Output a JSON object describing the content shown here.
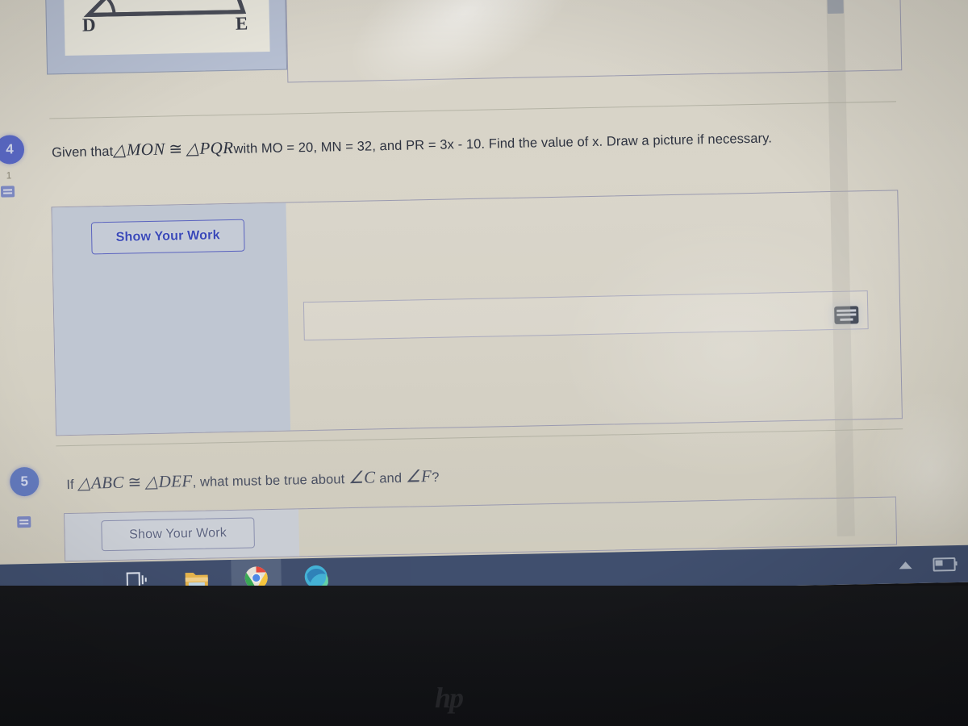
{
  "app": {
    "background_color": "#d6d2c6",
    "accent_color": "#4f5fc4"
  },
  "scrollbar": {
    "name": "vertical-scrollbar",
    "up_arrow": "▲"
  },
  "diagram": {
    "caption": "triangle-diagram",
    "vertex_left_label": "D",
    "vertex_right_label": "E"
  },
  "questions": [
    {
      "number": "4",
      "points": "1",
      "text_prefix": "Given that",
      "triangle_1": "△MON",
      "congruent_symbol": "≅",
      "triangle_2": "△PQR",
      "text_middle": "with MO = 20, MN = 32, and PR = 3x - 10. Find the value of x. Draw a picture if necessary.",
      "show_your_work_label": "Show Your Work",
      "answer_value": "",
      "answer_placeholder": "",
      "keyboard_icon": "keyboard-icon"
    },
    {
      "number": "5",
      "points": "",
      "text_prefix": "If",
      "triangle_1": "△ABC",
      "congruent_symbol": "≅",
      "triangle_2": "△DEF",
      "text_middle": ", what must be true about",
      "angle_1": "∠C",
      "text_and": "and",
      "angle_2": "∠F",
      "text_suffix": "?",
      "show_your_work_label": "Show Your Work"
    }
  ],
  "taskbar": {
    "items": [
      {
        "name": "task-view-icon",
        "label": "Task View"
      },
      {
        "name": "file-explorer-icon",
        "label": "File Explorer"
      },
      {
        "name": "chrome-icon",
        "label": "Google Chrome"
      },
      {
        "name": "edge-icon",
        "label": "Microsoft Edge"
      }
    ],
    "tray": [
      {
        "name": "show-hidden-icons-chevron",
        "label": "Show hidden icons"
      },
      {
        "name": "battery-icon",
        "label": "Battery"
      }
    ]
  },
  "device": {
    "brand_logo": "hp"
  }
}
